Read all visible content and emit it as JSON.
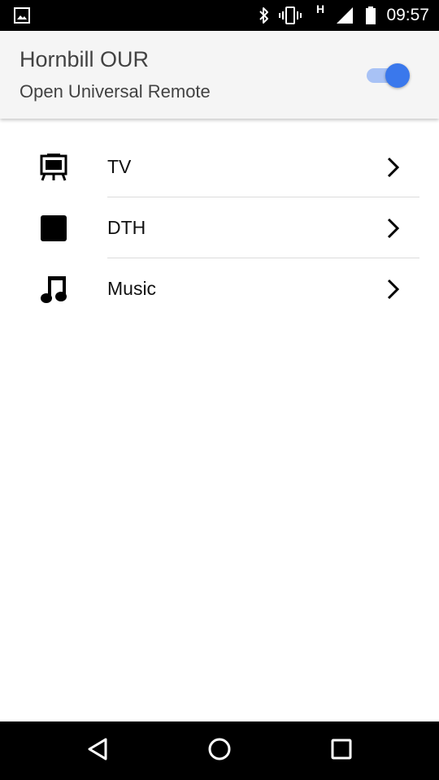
{
  "status_bar": {
    "time": "09:57",
    "network_type": "H",
    "icons": [
      "image-icon",
      "bluetooth-icon",
      "vibrate-icon",
      "signal-icon",
      "battery-icon"
    ]
  },
  "header": {
    "title": "Hornbill OUR",
    "subtitle": "Open Universal Remote",
    "toggle_on": true,
    "accent_color": "#3a78ec"
  },
  "devices": [
    {
      "label": "TV",
      "icon": "tv-icon"
    },
    {
      "label": "DTH",
      "icon": "stop-square-icon"
    },
    {
      "label": "Music",
      "icon": "music-note-icon"
    }
  ],
  "nav_bar": {
    "buttons": [
      "back-icon",
      "home-icon",
      "recents-icon"
    ]
  }
}
